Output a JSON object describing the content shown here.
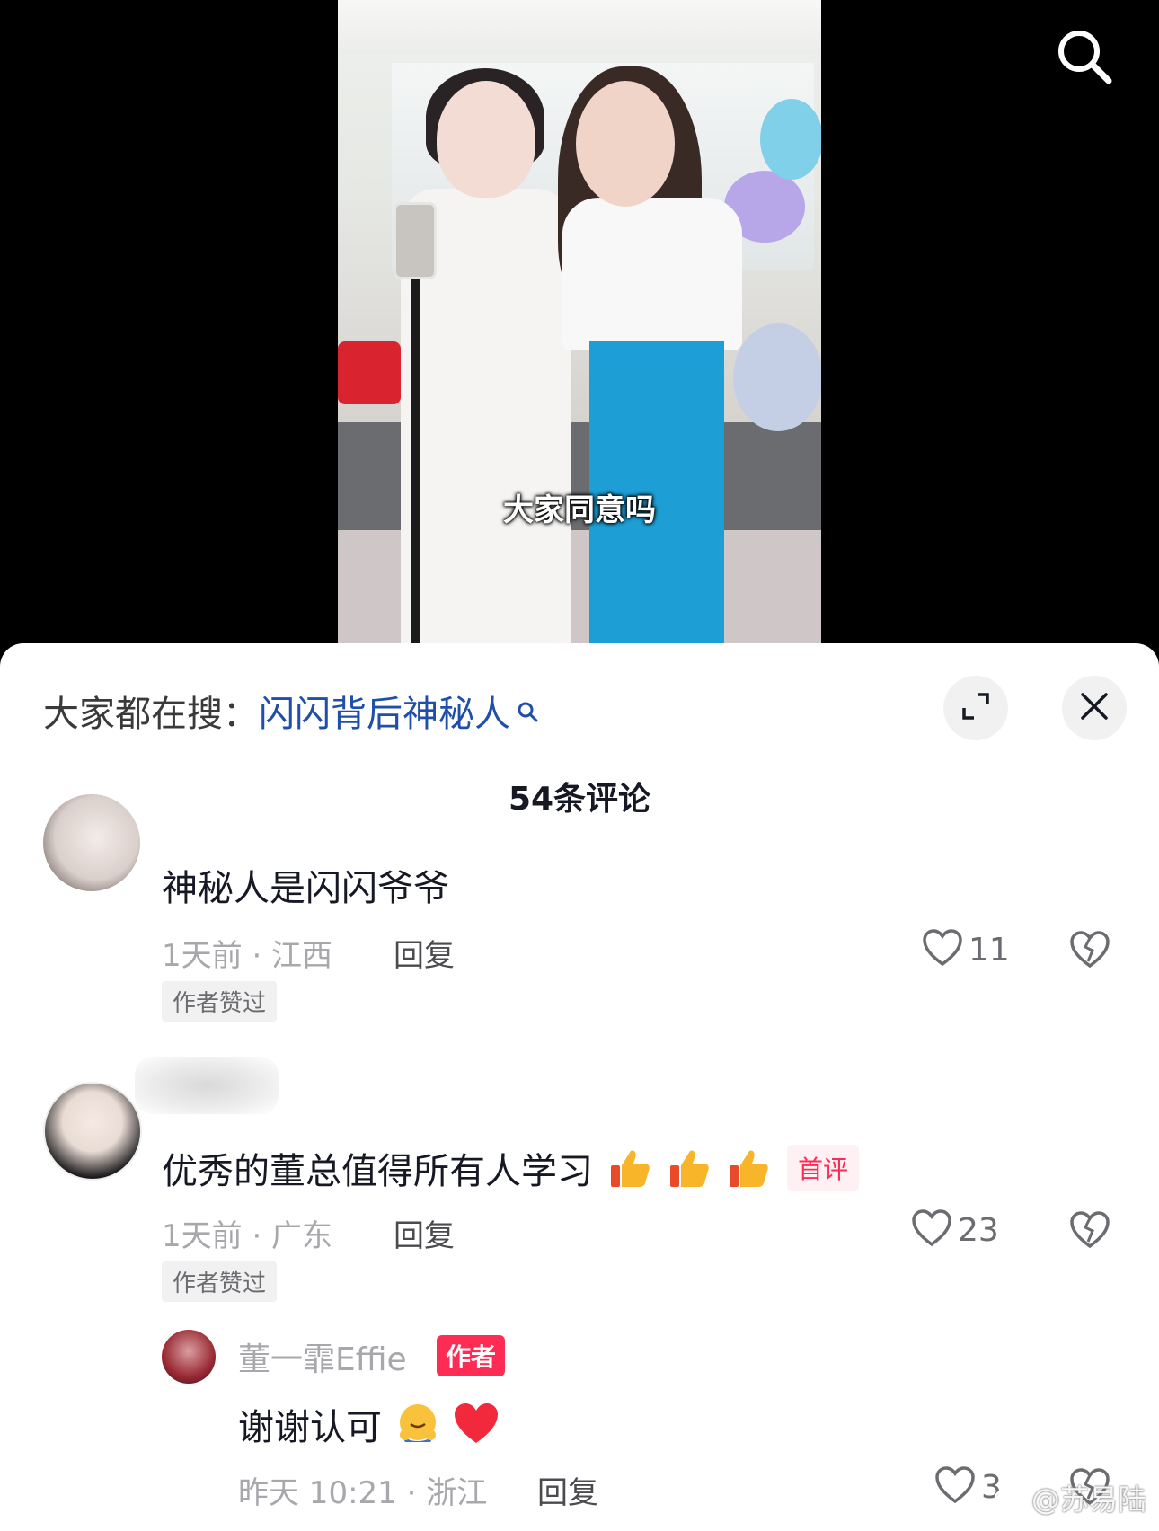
{
  "video": {
    "caption": "大家同意吗"
  },
  "panel": {
    "search_prefix": "大家都在搜：",
    "search_query": "闪闪背后神秘人",
    "comment_count": "54条评论"
  },
  "comments": [
    {
      "text": "神秘人是闪闪爷爷",
      "meta": "1天前 · 江西",
      "reply_label": "回复",
      "liked_tag": "作者赞过",
      "likes": "11"
    },
    {
      "text": "优秀的董总值得所有人学习",
      "badge": "首评",
      "meta": "1天前 · 广东",
      "reply_label": "回复",
      "liked_tag": "作者赞过",
      "likes": "23"
    }
  ],
  "reply": {
    "author": "董一霏Effie",
    "author_badge": "作者",
    "text": "谢谢认可",
    "meta": "昨天 10:21 · 浙江",
    "reply_label": "回复",
    "likes": "3"
  },
  "watermark": "@苏易陆",
  "icons": {
    "top_search": "search-icon",
    "expand": "expand-icon",
    "close": "close-icon",
    "like": "heart-outline-icon",
    "dislike": "broken-heart-icon"
  },
  "colors": {
    "accent_red": "#fe2c55",
    "search_link": "#1f4fa8",
    "meta_gray": "#a8a8ac"
  }
}
